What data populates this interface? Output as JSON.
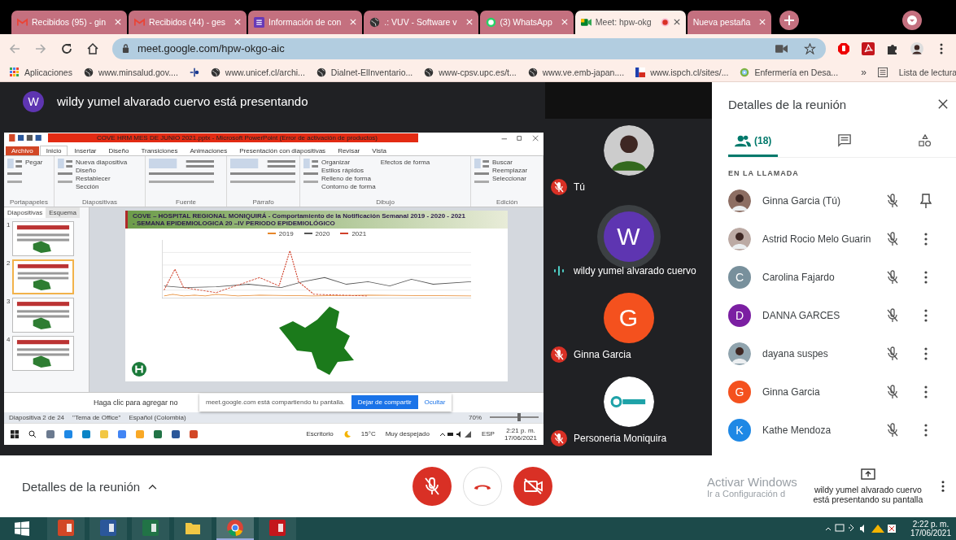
{
  "browser": {
    "tabs": [
      {
        "title": "Recibidos (95) - gin",
        "kind": "mail",
        "selected": false,
        "recording": false
      },
      {
        "title": "Recibidos (44) - ges",
        "kind": "mail",
        "selected": false,
        "recording": false
      },
      {
        "title": "Información de con",
        "kind": "form",
        "selected": false,
        "recording": false
      },
      {
        "title": ".: VUV - Software v",
        "kind": "globe",
        "selected": false,
        "recording": false
      },
      {
        "title": "(3) WhatsApp",
        "kind": "chat",
        "selected": false,
        "recording": false
      },
      {
        "title": "Meet: hpw-okg",
        "kind": "camera",
        "selected": true,
        "recording": true
      },
      {
        "title": "Nueva pestaña",
        "kind": "blank",
        "selected": false,
        "recording": false
      }
    ],
    "url": "meet.google.com/hpw-okgo-aic",
    "bookmarks": [
      {
        "label": "Aplicaciones",
        "kind": "apps"
      },
      {
        "label": "www.minsalud.gov....",
        "kind": "globe"
      },
      {
        "kind": "cross"
      },
      {
        "label": "www.unicef.cl/archi...",
        "kind": "globe"
      },
      {
        "label": "Dialnet-ElInventario...",
        "kind": "globe"
      },
      {
        "label": "www-cpsv.upc.es/t...",
        "kind": "globe"
      },
      {
        "label": "www.ve.emb-japan....",
        "kind": "globe"
      },
      {
        "label": "www.ispch.cl/sites/...",
        "kind": "flag"
      },
      {
        "label": "Enfermería en Desa...",
        "kind": "disc"
      }
    ],
    "more_bookmarks": "»",
    "reading_list": "Lista de lectura"
  },
  "presenter": {
    "initial": "W",
    "text": "wildy yumel alvarado cuervo está presentando"
  },
  "shared_screen": {
    "title": "COVE HRM MES DE JUNIO 2021.pptx  -  Microsoft PowerPoint (Error de activación de productos)",
    "ribbon_tabs": [
      {
        "label": "Archivo",
        "selected": false,
        "kind": "file"
      },
      {
        "label": "Inicio",
        "selected": true,
        "kind": "tab"
      },
      {
        "label": "Insertar",
        "selected": false,
        "kind": "tab"
      },
      {
        "label": "Diseño",
        "selected": false,
        "kind": "tab"
      },
      {
        "label": "Transiciones",
        "selected": false,
        "kind": "tab"
      },
      {
        "label": "Animaciones",
        "selected": false,
        "kind": "tab"
      },
      {
        "label": "Presentación con diapositivas",
        "selected": false,
        "kind": "tab"
      },
      {
        "label": "Revisar",
        "selected": false,
        "kind": "tab"
      },
      {
        "label": "Vista",
        "selected": false,
        "kind": "tab"
      }
    ],
    "groups": [
      {
        "label": "Portapapeles",
        "buttons": [
          "Pegar"
        ]
      },
      {
        "label": "Diapositivas",
        "buttons": [
          "Nueva diapositiva",
          "Diseño",
          "Restablecer",
          "Sección"
        ]
      },
      {
        "label": "Fuente"
      },
      {
        "label": "Párrafo"
      },
      {
        "label": "Dibujo",
        "buttons": [
          "Organizar",
          "Estilos rápidos",
          "Relleno de forma",
          "Contorno de forma",
          "Efectos de forma"
        ]
      },
      {
        "label": "Edición",
        "buttons": [
          "Buscar",
          "Reemplazar",
          "Seleccionar"
        ]
      }
    ],
    "pane_tabs": [
      {
        "label": "Diapositivas",
        "selected": true
      },
      {
        "label": "Esquema",
        "selected": false
      }
    ],
    "thumbnails": [
      {
        "number": "1",
        "selected": false
      },
      {
        "number": "2",
        "selected": true
      },
      {
        "number": "3",
        "selected": false
      },
      {
        "number": "4",
        "selected": false
      }
    ],
    "slide_title": [
      "COVE – HOSPITAL REGIONAL MONIQUIRÁ - Comportamiento de la Notificación Semanal 2019 - 2020 - 2021",
      "- SEMANA EPIDEMIOLOGICA  20 –IV PERIODO EPIDEMIOLÓGICO"
    ],
    "legend": [
      {
        "label": "2019",
        "color": "#e6862a"
      },
      {
        "label": "2020",
        "color": "#555555"
      },
      {
        "label": "2021",
        "color": "#d0402a"
      }
    ],
    "notes_placeholder": "Haga clic para agregar no",
    "share_bar": {
      "text": "meet.google.com está compartiendo tu pantalla.",
      "stop": "Dejar de compartir",
      "hide": "Ocultar"
    },
    "status": [
      "Diapositiva 2 de 24",
      "\"Tema de Office\"",
      "Español (Colombia)"
    ],
    "zoom": "70%",
    "zoom_slider": {
      "level": 0.6
    },
    "taskbar": {
      "desktop": "Escritorio",
      "temp": "15°C",
      "weather": "Muy despejado",
      "lang": "ESP",
      "time": "2:21 p. m.",
      "date": "17/06/2021"
    }
  },
  "tiles": [
    {
      "name": "Tú",
      "kind": "photo",
      "color": "#cccccc",
      "muted": true,
      "speaking": false
    },
    {
      "name": "wildy yumel alvarado cuervo",
      "kind": "letter",
      "initial": "W",
      "color": "#5e35b1",
      "muted": false,
      "speaking": true
    },
    {
      "name": "Ginna Garcia",
      "kind": "letter",
      "initial": "G",
      "color": "#f4511e",
      "muted": true,
      "speaking": false
    },
    {
      "name": "Personeria Moniquira",
      "kind": "logo",
      "color": "#ffffff",
      "muted": true,
      "speaking": false
    }
  ],
  "panel": {
    "title": "Detalles de la reunión",
    "tabs": [
      {
        "kind": "people",
        "count": "(18)",
        "selected": true
      },
      {
        "kind": "chat",
        "selected": false
      },
      {
        "kind": "activities",
        "selected": false
      }
    ],
    "section": "EN LA LLAMADA",
    "participants": [
      {
        "name": "Ginna Garcia (Tú)",
        "kind": "photo",
        "color": "#8d6e63",
        "pinnable": true
      },
      {
        "name": "Astrid Rocio Melo Guarin",
        "kind": "photo",
        "color": "#bcaaa4",
        "pinnable": false
      },
      {
        "name": "Carolina Fajardo",
        "kind": "letter",
        "initial": "C",
        "color": "#78909c",
        "pinnable": false
      },
      {
        "name": "DANNA GARCES",
        "kind": "letter",
        "initial": "D",
        "color": "#7b1fa2",
        "pinnable": false
      },
      {
        "name": "dayana suspes",
        "kind": "photo",
        "color": "#90a4ae",
        "pinnable": false
      },
      {
        "name": "Ginna Garcia",
        "kind": "letter",
        "initial": "G",
        "color": "#f4511e",
        "pinnable": false
      },
      {
        "name": "Kathe Mendoza",
        "kind": "letter",
        "initial": "K",
        "color": "#1e88e5",
        "pinnable": false
      }
    ]
  },
  "bottom": {
    "details": "Detalles de la reunión",
    "controls": [
      {
        "kind": "mic-off"
      },
      {
        "kind": "hang-up"
      },
      {
        "kind": "camera-off"
      }
    ],
    "activation": {
      "title": "Activar Windows",
      "text": "Ir a Configuración d"
    },
    "toast": "wildy yumel alvarado cuervo está presentando su pantalla"
  },
  "taskbar": {
    "apps": [
      {
        "kind": "powerpoint",
        "selected": false
      },
      {
        "kind": "word",
        "selected": false
      },
      {
        "kind": "excel",
        "selected": false
      },
      {
        "kind": "explorer",
        "selected": false
      },
      {
        "kind": "chrome",
        "selected": true
      },
      {
        "kind": "acrobat",
        "selected": false
      }
    ],
    "time": "2:22 p. m.",
    "date": "17/06/2021"
  }
}
